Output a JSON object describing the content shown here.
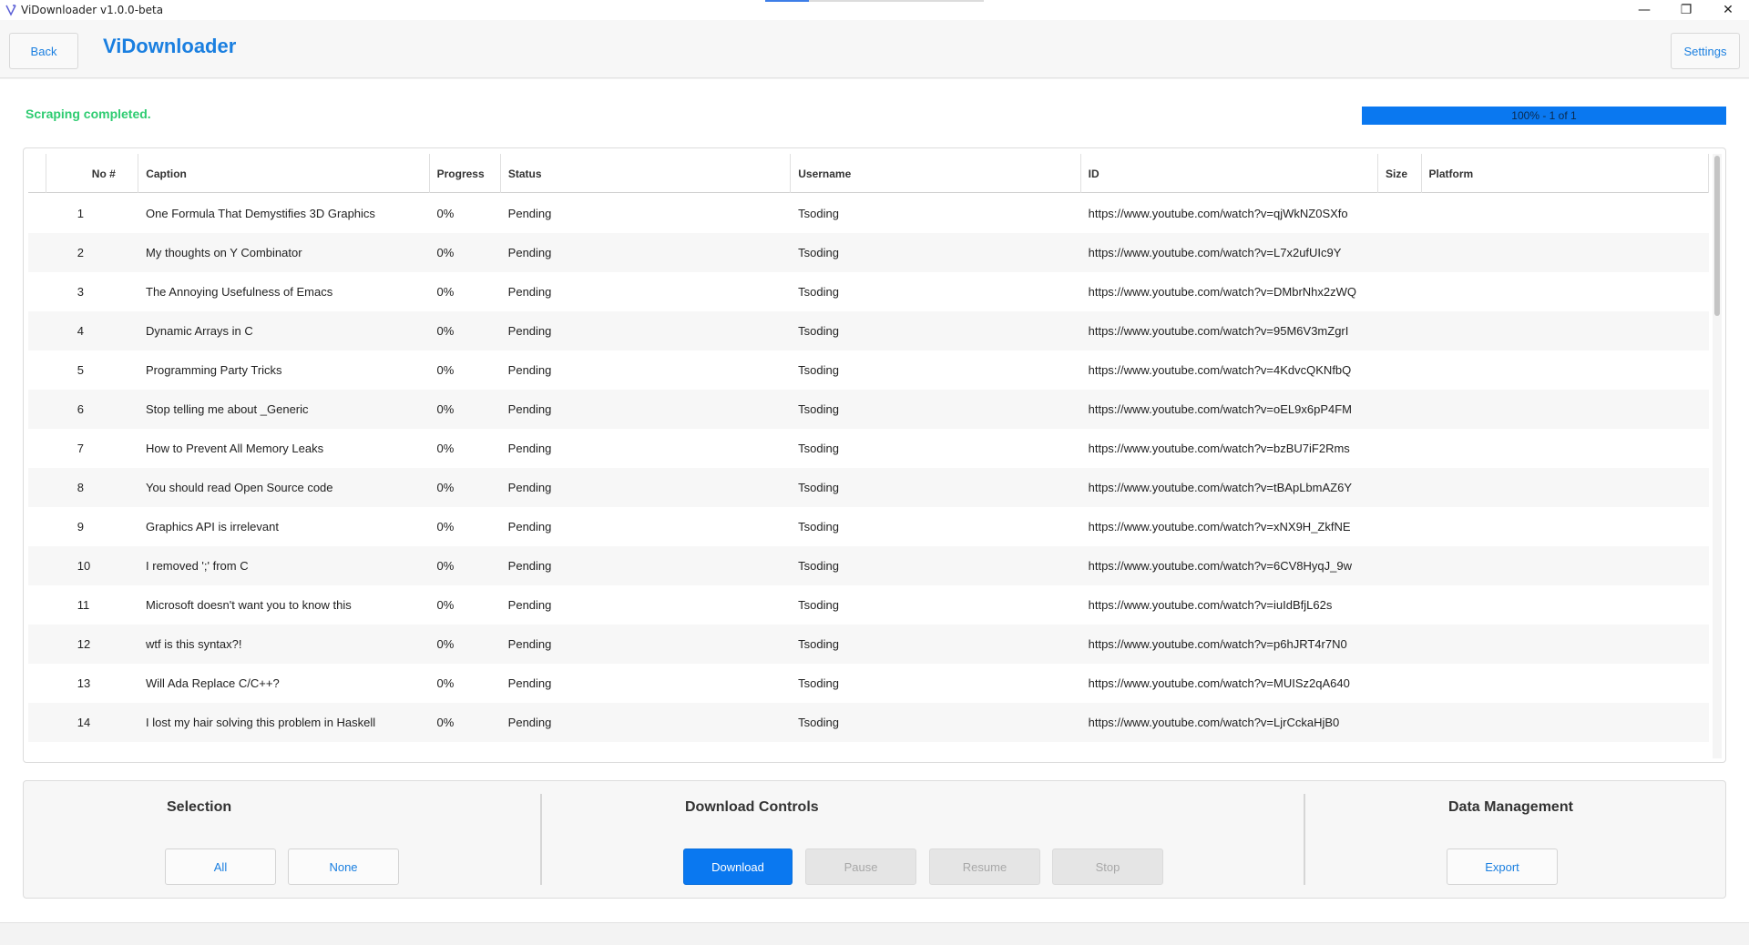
{
  "window": {
    "title": "ViDownloader v1.0.0-beta",
    "minimize_glyph": "—",
    "restore_glyph": "❐",
    "close_glyph": "✕"
  },
  "header": {
    "back_label": "Back",
    "app_name": "ViDownloader",
    "settings_label": "Settings"
  },
  "status": {
    "message": "Scraping completed.",
    "progress_text": "100% - 1 of 1",
    "progress_percent": 100
  },
  "table": {
    "columns": [
      "",
      "No #",
      "Caption",
      "Progress",
      "Status",
      "Username",
      "ID",
      "Size",
      "Platform"
    ],
    "rows": [
      {
        "no": "1",
        "caption": "One Formula That Demystifies 3D Graphics",
        "progress": "0%",
        "status": "Pending",
        "username": "Tsoding",
        "id": "https://www.youtube.com/watch?v=qjWkNZ0SXfo",
        "size": "",
        "platform": ""
      },
      {
        "no": "2",
        "caption": "My thoughts on Y Combinator",
        "progress": "0%",
        "status": "Pending",
        "username": "Tsoding",
        "id": "https://www.youtube.com/watch?v=L7x2ufUIc9Y",
        "size": "",
        "platform": ""
      },
      {
        "no": "3",
        "caption": "The Annoying Usefulness of Emacs",
        "progress": "0%",
        "status": "Pending",
        "username": "Tsoding",
        "id": "https://www.youtube.com/watch?v=DMbrNhx2zWQ",
        "size": "",
        "platform": ""
      },
      {
        "no": "4",
        "caption": "Dynamic Arrays in C",
        "progress": "0%",
        "status": "Pending",
        "username": "Tsoding",
        "id": "https://www.youtube.com/watch?v=95M6V3mZgrI",
        "size": "",
        "platform": ""
      },
      {
        "no": "5",
        "caption": "Programming Party Tricks",
        "progress": "0%",
        "status": "Pending",
        "username": "Tsoding",
        "id": "https://www.youtube.com/watch?v=4KdvcQKNfbQ",
        "size": "",
        "platform": ""
      },
      {
        "no": "6",
        "caption": "Stop telling me about _Generic",
        "progress": "0%",
        "status": "Pending",
        "username": "Tsoding",
        "id": "https://www.youtube.com/watch?v=oEL9x6pP4FM",
        "size": "",
        "platform": ""
      },
      {
        "no": "7",
        "caption": "How to Prevent All Memory Leaks",
        "progress": "0%",
        "status": "Pending",
        "username": "Tsoding",
        "id": "https://www.youtube.com/watch?v=bzBU7iF2Rms",
        "size": "",
        "platform": ""
      },
      {
        "no": "8",
        "caption": "You should read Open Source code",
        "progress": "0%",
        "status": "Pending",
        "username": "Tsoding",
        "id": "https://www.youtube.com/watch?v=tBApLbmAZ6Y",
        "size": "",
        "platform": ""
      },
      {
        "no": "9",
        "caption": "Graphics API is irrelevant",
        "progress": "0%",
        "status": "Pending",
        "username": "Tsoding",
        "id": "https://www.youtube.com/watch?v=xNX9H_ZkfNE",
        "size": "",
        "platform": ""
      },
      {
        "no": "10",
        "caption": "I removed ';' from C",
        "progress": "0%",
        "status": "Pending",
        "username": "Tsoding",
        "id": "https://www.youtube.com/watch?v=6CV8HyqJ_9w",
        "size": "",
        "platform": ""
      },
      {
        "no": "11",
        "caption": "Microsoft doesn't want you to know this",
        "progress": "0%",
        "status": "Pending",
        "username": "Tsoding",
        "id": "https://www.youtube.com/watch?v=iuIdBfjL62s",
        "size": "",
        "platform": ""
      },
      {
        "no": "12",
        "caption": "wtf is this syntax?!",
        "progress": "0%",
        "status": "Pending",
        "username": "Tsoding",
        "id": "https://www.youtube.com/watch?v=p6hJRT4r7N0",
        "size": "",
        "platform": ""
      },
      {
        "no": "13",
        "caption": "Will Ada Replace C/C++?",
        "progress": "0%",
        "status": "Pending",
        "username": "Tsoding",
        "id": "https://www.youtube.com/watch?v=MUISz2qA640",
        "size": "",
        "platform": ""
      },
      {
        "no": "14",
        "caption": "I lost my hair solving this problem in Haskell",
        "progress": "0%",
        "status": "Pending",
        "username": "Tsoding",
        "id": "https://www.youtube.com/watch?v=LjrCckaHjB0",
        "size": "",
        "platform": ""
      }
    ]
  },
  "controls": {
    "selection": {
      "title": "Selection",
      "all_label": "All",
      "none_label": "None"
    },
    "download": {
      "title": "Download Controls",
      "download_label": "Download",
      "pause_label": "Pause",
      "resume_label": "Resume",
      "stop_label": "Stop"
    },
    "data": {
      "title": "Data Management",
      "export_label": "Export"
    }
  },
  "colors": {
    "accent": "#1a7fe0",
    "primary_button": "#0a78f0",
    "success_text": "#2ecc71",
    "disabled_button": "#e5e5e5"
  }
}
